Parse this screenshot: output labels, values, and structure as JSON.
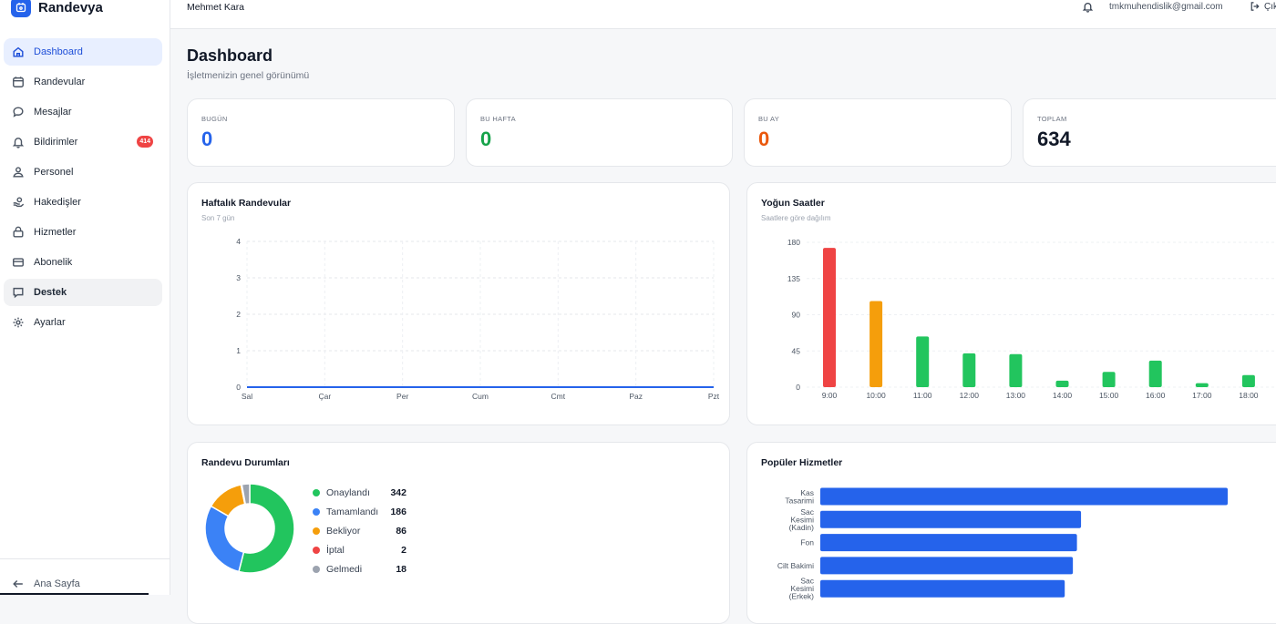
{
  "app": {
    "name": "Randevya"
  },
  "sidebar": {
    "items": [
      {
        "label": "Dashboard",
        "icon": "home-icon"
      },
      {
        "label": "Randevular",
        "icon": "calendar-icon"
      },
      {
        "label": "Mesajlar",
        "icon": "message-icon"
      },
      {
        "label": "Bildirimler",
        "icon": "bell-icon",
        "badge": "414"
      },
      {
        "label": "Personel",
        "icon": "person-icon"
      },
      {
        "label": "Hakedişler",
        "icon": "money-hand-icon"
      },
      {
        "label": "Hizmetler",
        "icon": "service-icon"
      },
      {
        "label": "Abonelik",
        "icon": "card-icon"
      },
      {
        "label": "Destek",
        "icon": "support-icon"
      },
      {
        "label": "Ayarlar",
        "icon": "gear-icon"
      }
    ],
    "footer": {
      "label": "Ana Sayfa",
      "icon": "arrow-left-icon"
    }
  },
  "topbar": {
    "user": "Mehmet Kara",
    "email": "tmkmuhendislik@gmail.com",
    "logout_label": "Çık"
  },
  "page": {
    "title": "Dashboard",
    "subtitle": "İşletmenizin genel görünümü"
  },
  "stats": [
    {
      "label": "BUGÜN",
      "value": "0",
      "color": "#2563eb"
    },
    {
      "label": "BU HAFTA",
      "value": "0",
      "color": "#16a34a"
    },
    {
      "label": "BU AY",
      "value": "0",
      "color": "#ea580c"
    },
    {
      "label": "TOPLAM",
      "value": "634",
      "color": "#111827"
    }
  ],
  "weekly": {
    "title": "Haftalık Randevular",
    "subtitle": "Son 7 gün"
  },
  "hours": {
    "title": "Yoğun Saatler",
    "subtitle": "Saatlere göre dağılım"
  },
  "statuses": {
    "title": "Randevu Durumları"
  },
  "services": {
    "title": "Popüler Hizmetler"
  },
  "chart_data": [
    {
      "type": "line",
      "categories": [
        "Sal",
        "Çar",
        "Per",
        "Cum",
        "Cmt",
        "Paz",
        "Pzt"
      ],
      "series": [
        {
          "values": [
            0,
            0,
            0,
            0,
            0,
            0,
            0
          ],
          "color": "#2563eb"
        }
      ],
      "yticks": [
        0,
        1,
        2,
        3,
        4
      ],
      "ylim": [
        0,
        4
      ],
      "grid": true
    },
    {
      "type": "bar",
      "categories": [
        "9:00",
        "10:00",
        "11:00",
        "12:00",
        "13:00",
        "14:00",
        "15:00",
        "16:00",
        "17:00",
        "18:00"
      ],
      "values": [
        173,
        107,
        63,
        42,
        41,
        8,
        19,
        33,
        5,
        15
      ],
      "colors": [
        "#ef4444",
        "#f59e0b",
        "#22c55e",
        "#22c55e",
        "#22c55e",
        "#22c55e",
        "#22c55e",
        "#22c55e",
        "#22c55e",
        "#22c55e"
      ],
      "yticks": [
        0,
        45,
        90,
        135,
        180
      ],
      "ylim": [
        0,
        180
      ],
      "grid": true
    },
    {
      "type": "pie",
      "labels": [
        "Onaylandı",
        "Tamamlandı",
        "Bekliyor",
        "İptal",
        "Gelmedi"
      ],
      "values": [
        342,
        186,
        86,
        2,
        18
      ],
      "colors": [
        "#22c55e",
        "#3b82f6",
        "#f59e0b",
        "#ef4444",
        "#9ca3af"
      ],
      "legend": "right"
    },
    {
      "type": "bar",
      "orientation": "horizontal",
      "categories": [
        "Kas Tasarimi",
        "Sac Kesimi (Kadin)",
        "Fon",
        "Cilt Bakimi",
        "Sac Kesimi (Erkek)"
      ],
      "category_lines": [
        [
          "Kas",
          "Tasarimi"
        ],
        [
          "Sac",
          "Kesimi",
          "(Kadin)"
        ],
        [
          "Fon"
        ],
        [
          "Cilt Bakimi"
        ],
        [
          "Sac",
          "Kesimi",
          "(Erkek)"
        ]
      ],
      "values": [
        100,
        64,
        63,
        62,
        60
      ],
      "color": "#2563eb"
    }
  ]
}
